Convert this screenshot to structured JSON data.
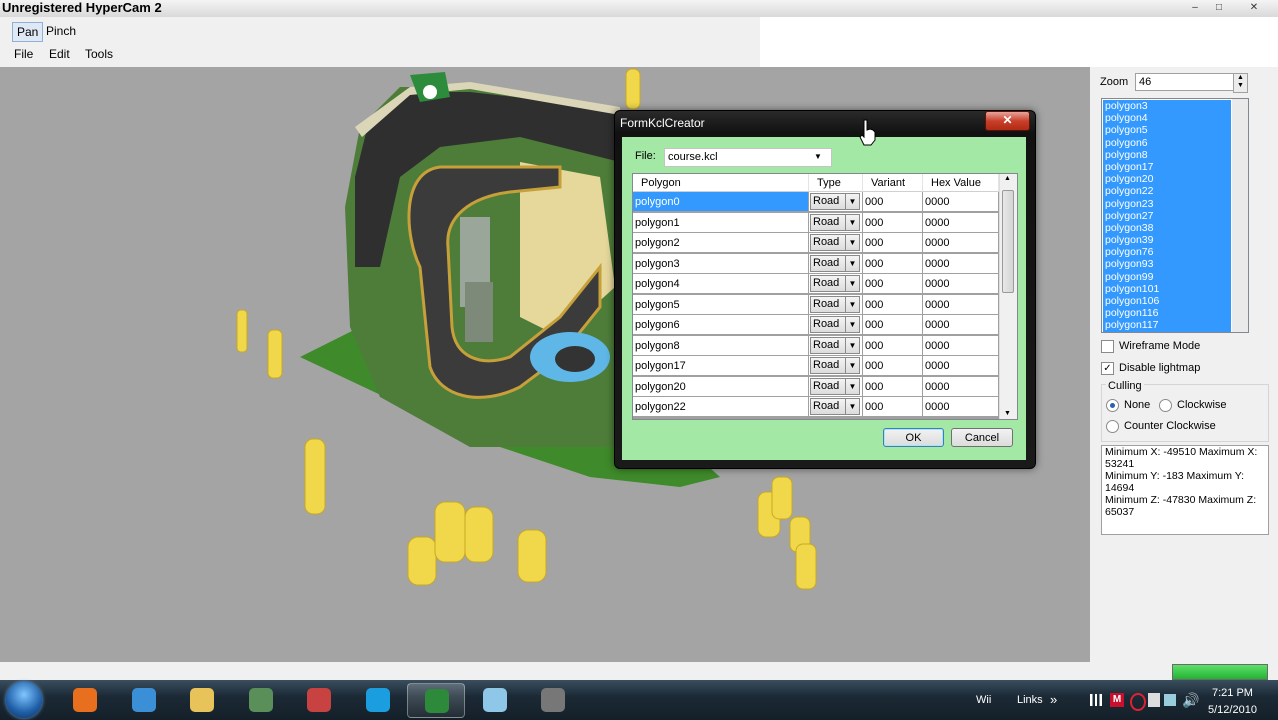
{
  "window": {
    "watermark": "Unregistered HyperCam 2",
    "min": "–",
    "max": "□",
    "close": "✕"
  },
  "toolbar": {
    "pan": "Pan",
    "pinch": "Pinch"
  },
  "menu": {
    "file": "File",
    "edit": "Edit",
    "tools": "Tools"
  },
  "panel": {
    "zoom_label": "Zoom",
    "zoom_value": "46",
    "polygons": [
      "polygon3",
      "polygon4",
      "polygon5",
      "polygon6",
      "polygon8",
      "polygon17",
      "polygon20",
      "polygon22",
      "polygon23",
      "polygon27",
      "polygon38",
      "polygon39",
      "polygon76",
      "polygon93",
      "polygon99",
      "polygon101",
      "polygon106",
      "polygon116",
      "polygon117"
    ],
    "wireframe_label": "Wireframe Mode",
    "wireframe_checked": false,
    "lightmap_label": "Disable lightmap",
    "lightmap_checked": true,
    "culling_label": "Culling",
    "culling_none": "None",
    "culling_clockwise": "Clockwise",
    "culling_counter": "Counter Clockwise",
    "culling_selected": "None",
    "minmax": [
      "Minimum X: -49510 Maximum X:",
      "53241",
      "Minimum Y: -183 Maximum Y: 14694",
      "Minimum Z: -47830 Maximum Z:",
      "65037"
    ]
  },
  "dialog": {
    "title": "FormKclCreator",
    "close": "✕",
    "file_label": "File:",
    "file_value": "course.kcl",
    "columns": [
      "Polygon",
      "Type",
      "Variant",
      "Hex Value"
    ],
    "rows": [
      {
        "polygon": "polygon0",
        "type": "Road",
        "variant": "000",
        "hex": "0000"
      },
      {
        "polygon": "polygon1",
        "type": "Road",
        "variant": "000",
        "hex": "0000"
      },
      {
        "polygon": "polygon2",
        "type": "Road",
        "variant": "000",
        "hex": "0000"
      },
      {
        "polygon": "polygon3",
        "type": "Road",
        "variant": "000",
        "hex": "0000"
      },
      {
        "polygon": "polygon4",
        "type": "Road",
        "variant": "000",
        "hex": "0000"
      },
      {
        "polygon": "polygon5",
        "type": "Road",
        "variant": "000",
        "hex": "0000"
      },
      {
        "polygon": "polygon6",
        "type": "Road",
        "variant": "000",
        "hex": "0000"
      },
      {
        "polygon": "polygon8",
        "type": "Road",
        "variant": "000",
        "hex": "0000"
      },
      {
        "polygon": "polygon17",
        "type": "Road",
        "variant": "000",
        "hex": "0000"
      },
      {
        "polygon": "polygon20",
        "type": "Road",
        "variant": "000",
        "hex": "0000"
      },
      {
        "polygon": "polygon22",
        "type": "Road",
        "variant": "000",
        "hex": "0000"
      }
    ],
    "selected_row": 0,
    "ok": "OK",
    "cancel": "Cancel"
  },
  "taskbar": {
    "icons": [
      "firefox-icon",
      "chrome-icon",
      "explorer-folder-icon",
      "device-manager-icon",
      "snipping-tool-icon",
      "skype-icon",
      "kcl-editor-icon",
      "notes-icon",
      "game-tool-icon"
    ],
    "active_index": 6,
    "tray_wii": "Wii",
    "tray_links": "Links",
    "tray_more": "»",
    "time": "7:21 PM",
    "date": "5/12/2010"
  }
}
